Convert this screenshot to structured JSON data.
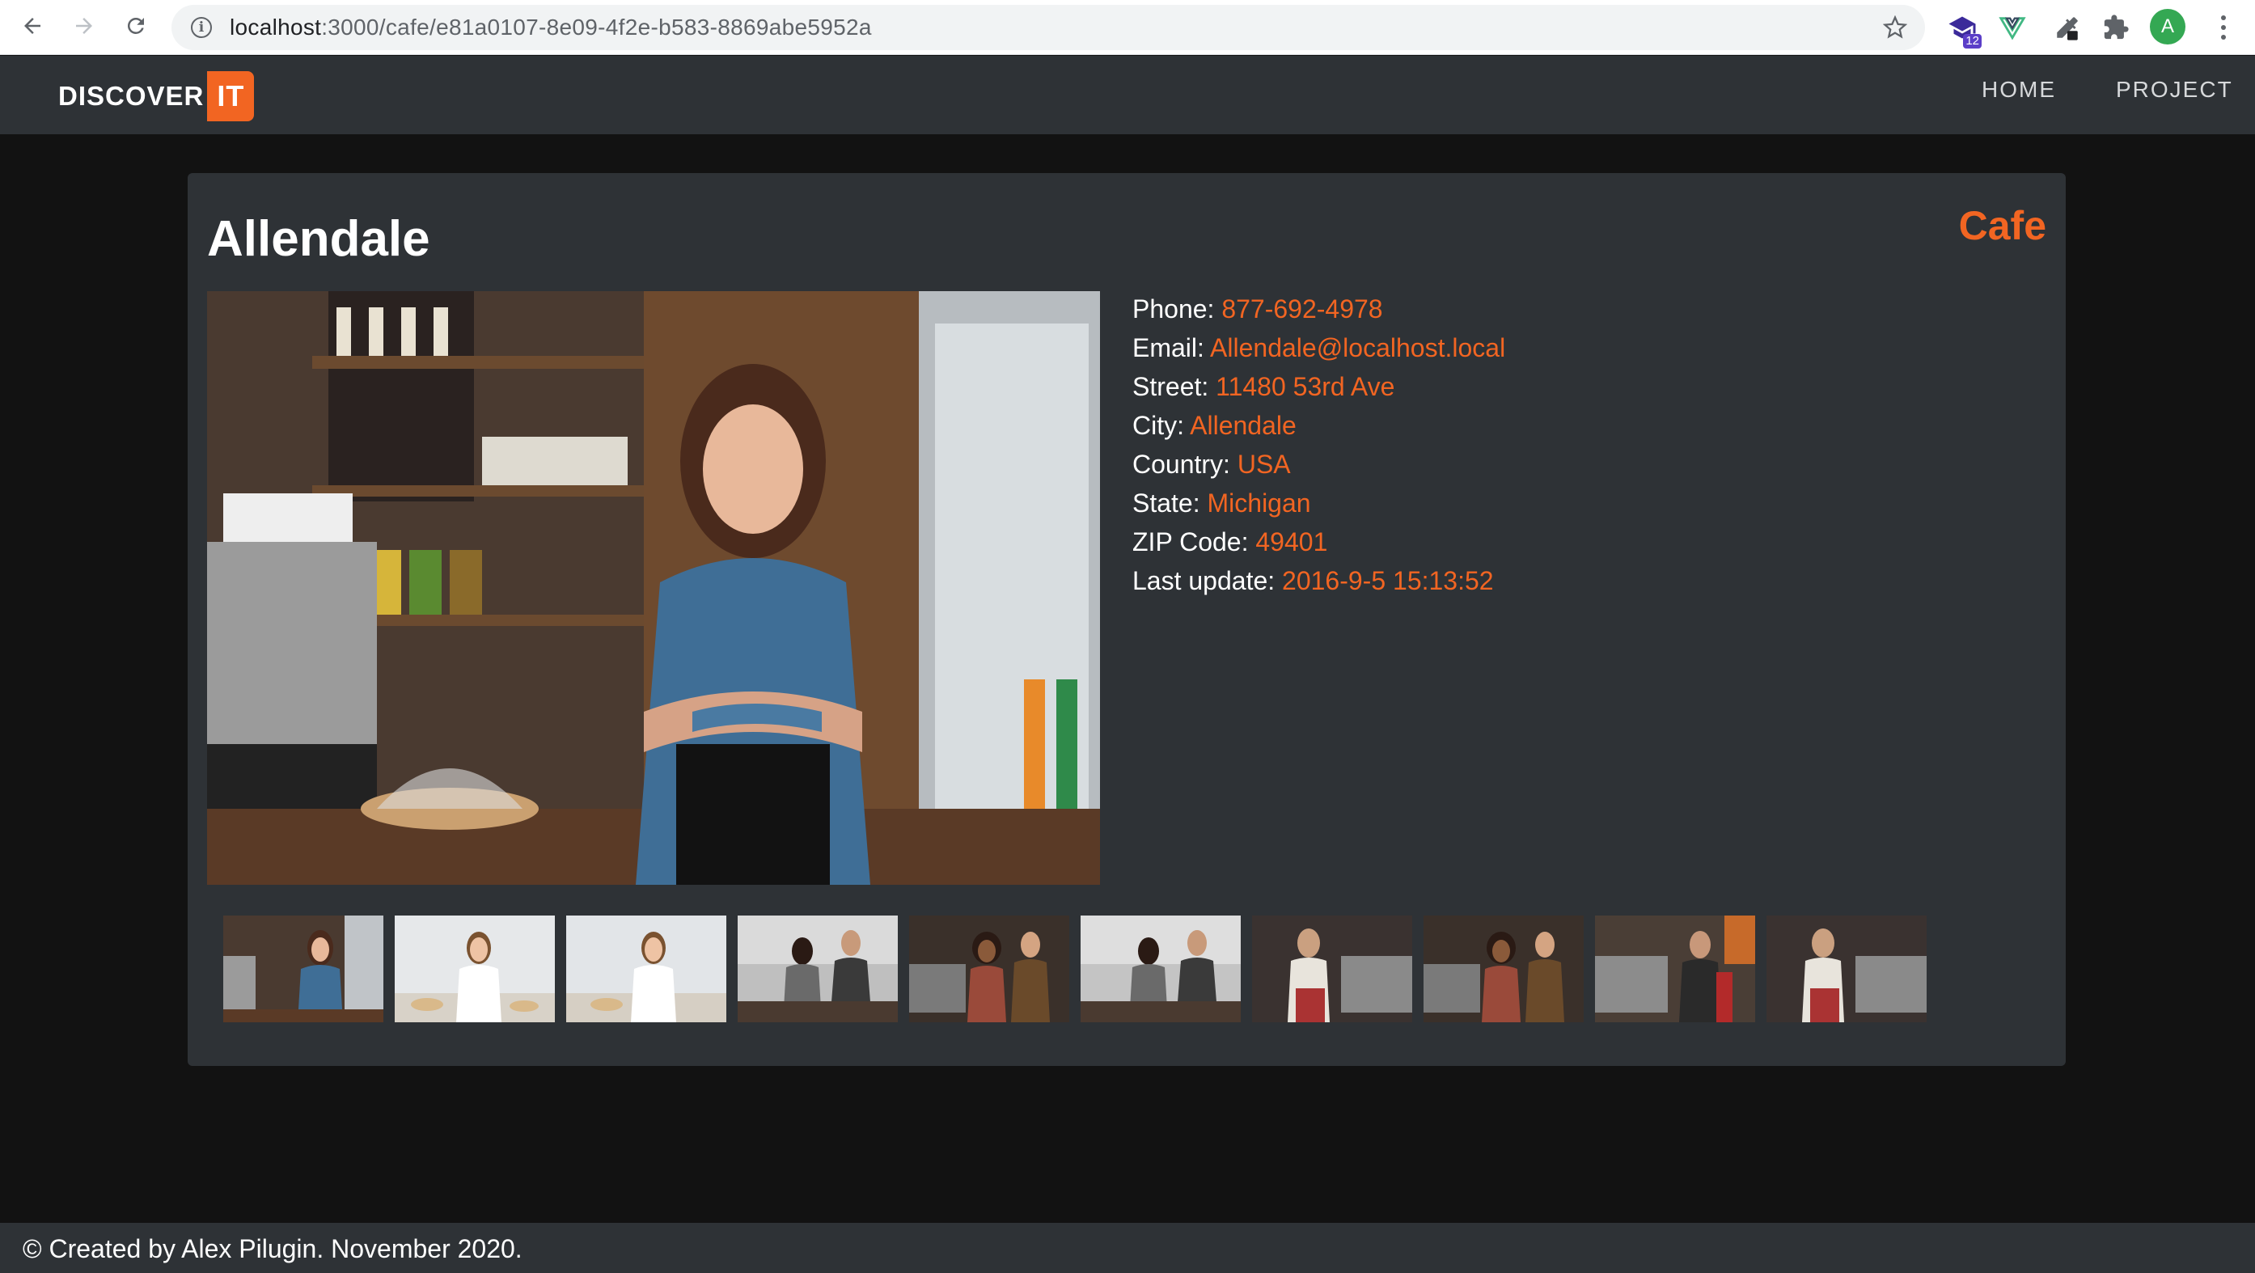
{
  "browser": {
    "url_host": "localhost",
    "url_path": ":3000/cafe/e81a0107-8e09-4f2e-b583-8869abe5952a",
    "extension_badge": "12",
    "profile_initial": "A"
  },
  "header": {
    "logo_main": "DISCOVER",
    "logo_accent": "IT",
    "nav": [
      "HOME",
      "PROJECT"
    ]
  },
  "venue": {
    "name": "Allendale",
    "category": "Cafe",
    "details": [
      {
        "label": "Phone:",
        "value": "877-692-4978"
      },
      {
        "label": "Email:",
        "value": "Allendale@localhost.local"
      },
      {
        "label": "Street:",
        "value": "11480 53rd Ave"
      },
      {
        "label": "City:",
        "value": "Allendale"
      },
      {
        "label": "Country:",
        "value": "USA"
      },
      {
        "label": "State:",
        "value": "Michigan"
      },
      {
        "label": "ZIP Code:",
        "value": "49401"
      },
      {
        "label": "Last update:",
        "value": "2016-9-5 15:13:52"
      }
    ]
  },
  "footer": {
    "text": "© Created by Alex Pilugin. November 2020."
  },
  "colors": {
    "accent": "#f26522",
    "background": "#121212",
    "surface": "#2e3236"
  },
  "icons": [
    "back-arrow-icon",
    "forward-arrow-icon",
    "reload-icon",
    "info-icon",
    "star-icon",
    "extensions-icon",
    "more-menu-icon"
  ]
}
